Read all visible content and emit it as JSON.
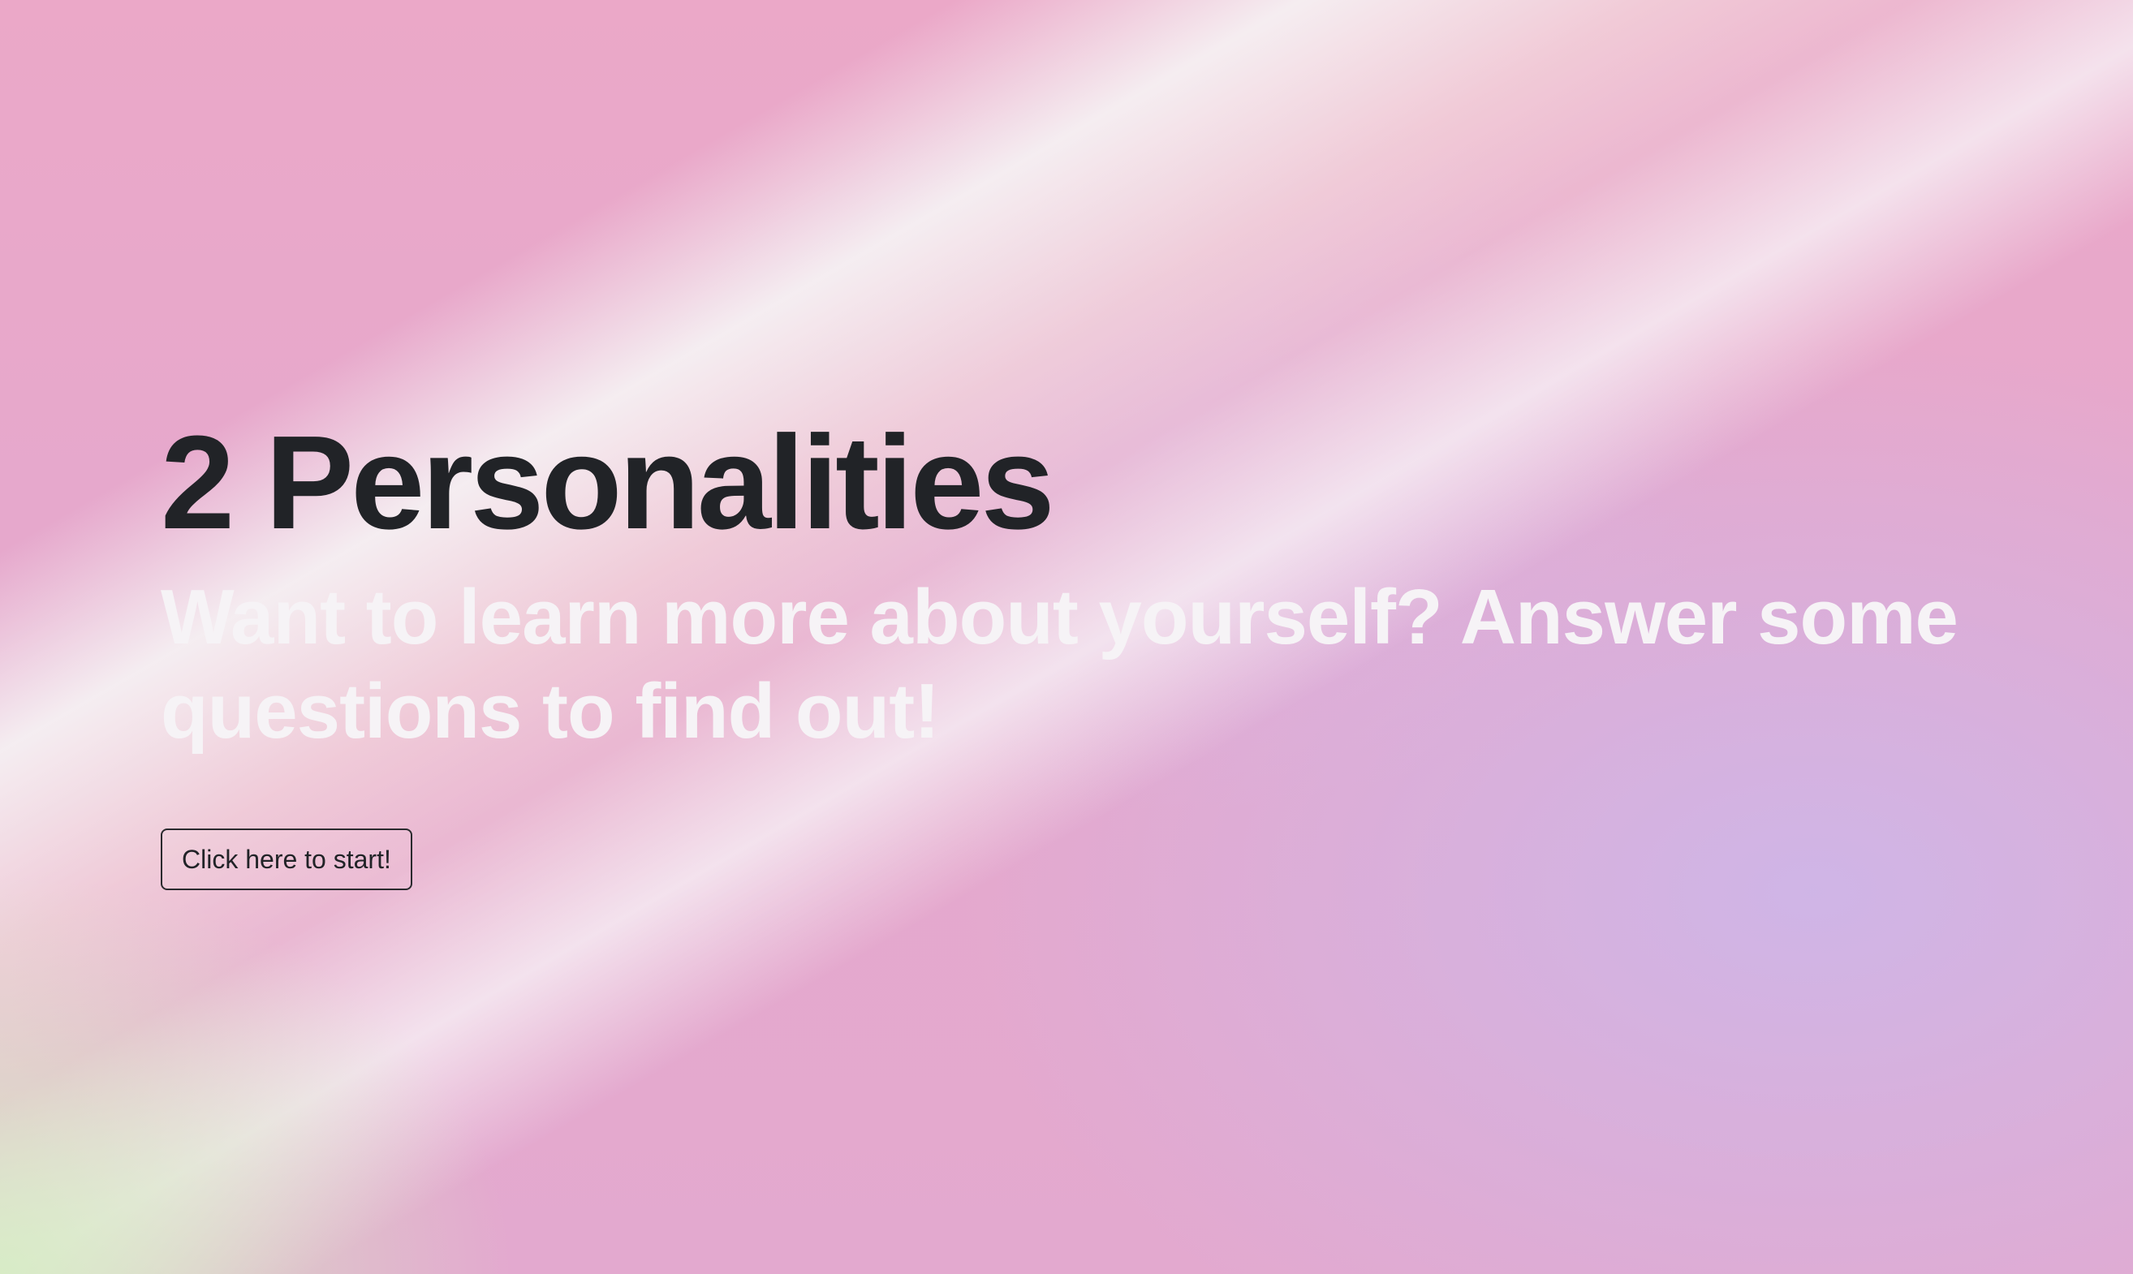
{
  "hero": {
    "title": "2 Personalities",
    "subtitle": "Want to learn more about yourself? Answer some questions to find out!",
    "start_button_label": "Click here to start!"
  },
  "colors": {
    "title": "#212327",
    "subtitle": "#f6f3f6",
    "background_pink": "#eba8c8",
    "background_lavender": "#ceb6e8",
    "background_green": "#d6ecc4"
  }
}
